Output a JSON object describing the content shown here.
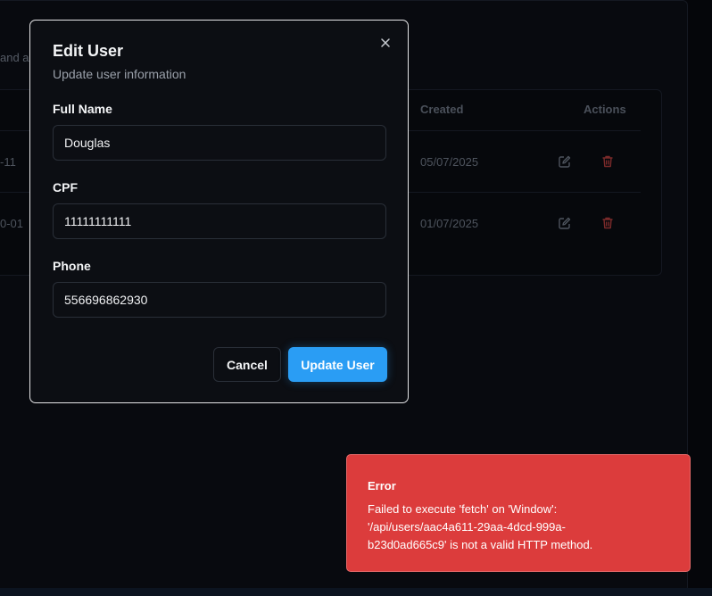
{
  "background": {
    "subtitle_fragment": "and a",
    "table": {
      "headers": {
        "created": "Created",
        "actions": "Actions"
      },
      "rows": [
        {
          "date_fragment": "-11",
          "created": "05/07/2025"
        },
        {
          "date_fragment": "0-01",
          "created": "01/07/2025"
        }
      ]
    }
  },
  "modal": {
    "title": "Edit User",
    "subtitle": "Update user information",
    "fields": {
      "full_name": {
        "label": "Full Name",
        "value": "Douglas"
      },
      "cpf": {
        "label": "CPF",
        "value": "11111111111"
      },
      "phone": {
        "label": "Phone",
        "value": "556696862930"
      }
    },
    "cancel_label": "Cancel",
    "update_label": "Update User"
  },
  "toast": {
    "title": "Error",
    "message": "Failed to execute 'fetch' on 'Window':\n'/api/users/aac4a611-29aa-4dcd-999a-\nb23d0ad665c9' is not a valid HTTP method."
  },
  "icons": {
    "close": "close-icon",
    "edit": "edit-icon",
    "delete": "trash-icon"
  },
  "colors": {
    "accent": "#2a9df4",
    "error": "#dc3c3c",
    "delete_icon": "#7a2a2a"
  }
}
